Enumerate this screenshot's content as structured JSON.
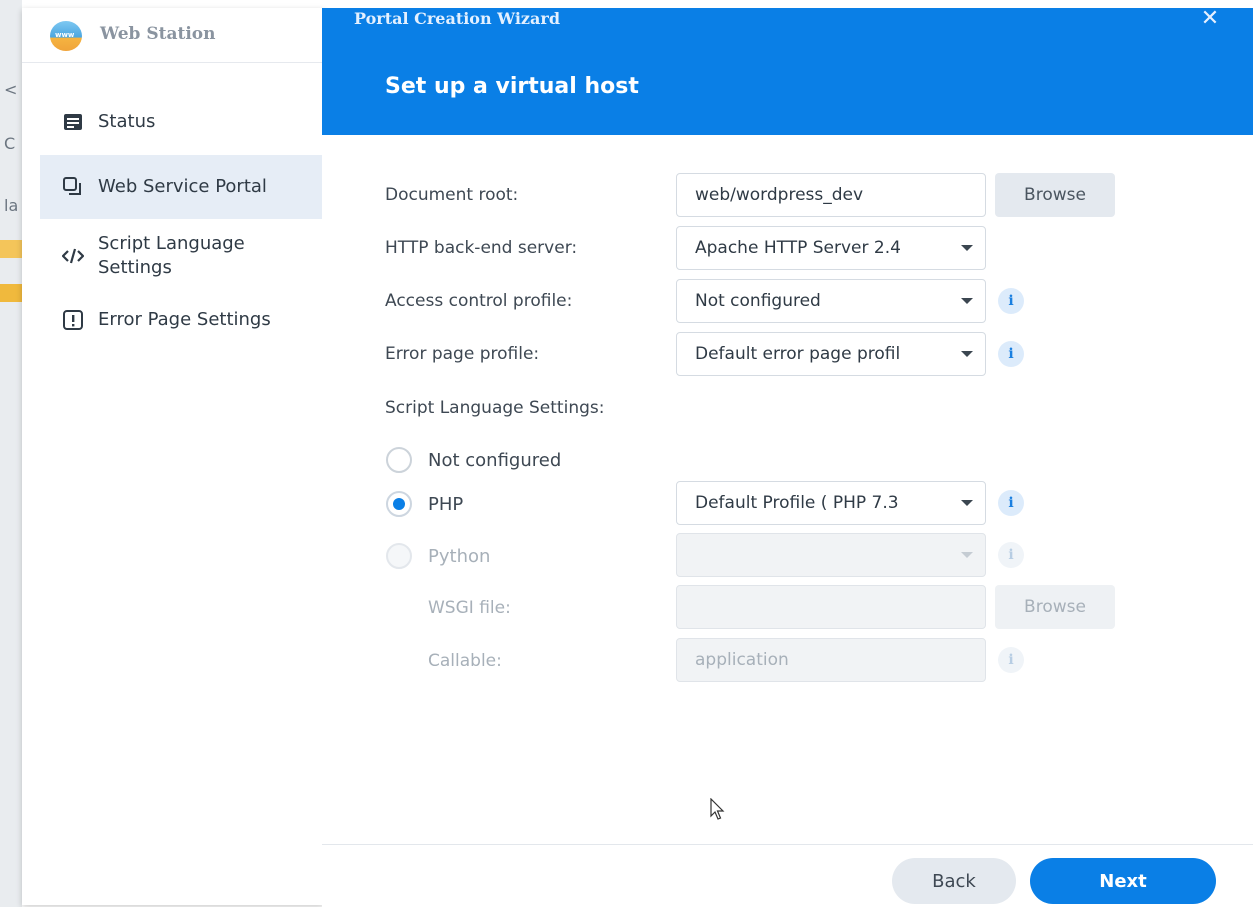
{
  "background": {
    "fragments": [
      "<",
      "C",
      "la"
    ]
  },
  "web_station": {
    "app_name": "Web Station",
    "logo_text": "www",
    "nav": [
      {
        "label": "Status",
        "icon": "status-icon",
        "active": false
      },
      {
        "label": "Web Service Portal",
        "icon": "portal-icon",
        "active": true
      },
      {
        "label_line1": "Script Language",
        "label_line2": "Settings",
        "icon": "code-icon",
        "active": false
      },
      {
        "label": "Error Page Settings",
        "icon": "error-page-icon",
        "active": false
      }
    ]
  },
  "wizard": {
    "title": "Portal Creation Wizard",
    "close_glyph": "✕",
    "step_title": "Set up a virtual host",
    "fields": {
      "document_root": {
        "label": "Document root:",
        "value": "web/wordpress_dev",
        "browse_label": "Browse"
      },
      "http_backend": {
        "label": "HTTP back-end server:",
        "value": "Apache HTTP Server 2.4"
      },
      "access_control": {
        "label": "Access control profile:",
        "value": "Not configured"
      },
      "error_page": {
        "label": "Error page profile:",
        "value": "Default error page profil"
      }
    },
    "script_language": {
      "label": "Script Language Settings:",
      "options": [
        {
          "label": "Not configured",
          "checked": false,
          "disabled": false
        },
        {
          "label": "PHP",
          "checked": true,
          "disabled": false,
          "value": "Default Profile ( PHP 7.3"
        },
        {
          "label": "Python",
          "checked": false,
          "disabled": true,
          "value": ""
        }
      ],
      "wsgi_label": "WSGI file:",
      "wsgi_value": "",
      "wsgi_browse_label": "Browse",
      "callable_label": "Callable:",
      "callable_placeholder": "application"
    },
    "footer": {
      "back_label": "Back",
      "next_label": "Next"
    },
    "info_glyph": "i"
  },
  "colors": {
    "accent": "#0a7fe6",
    "nav_active_bg": "#e6edf6"
  }
}
